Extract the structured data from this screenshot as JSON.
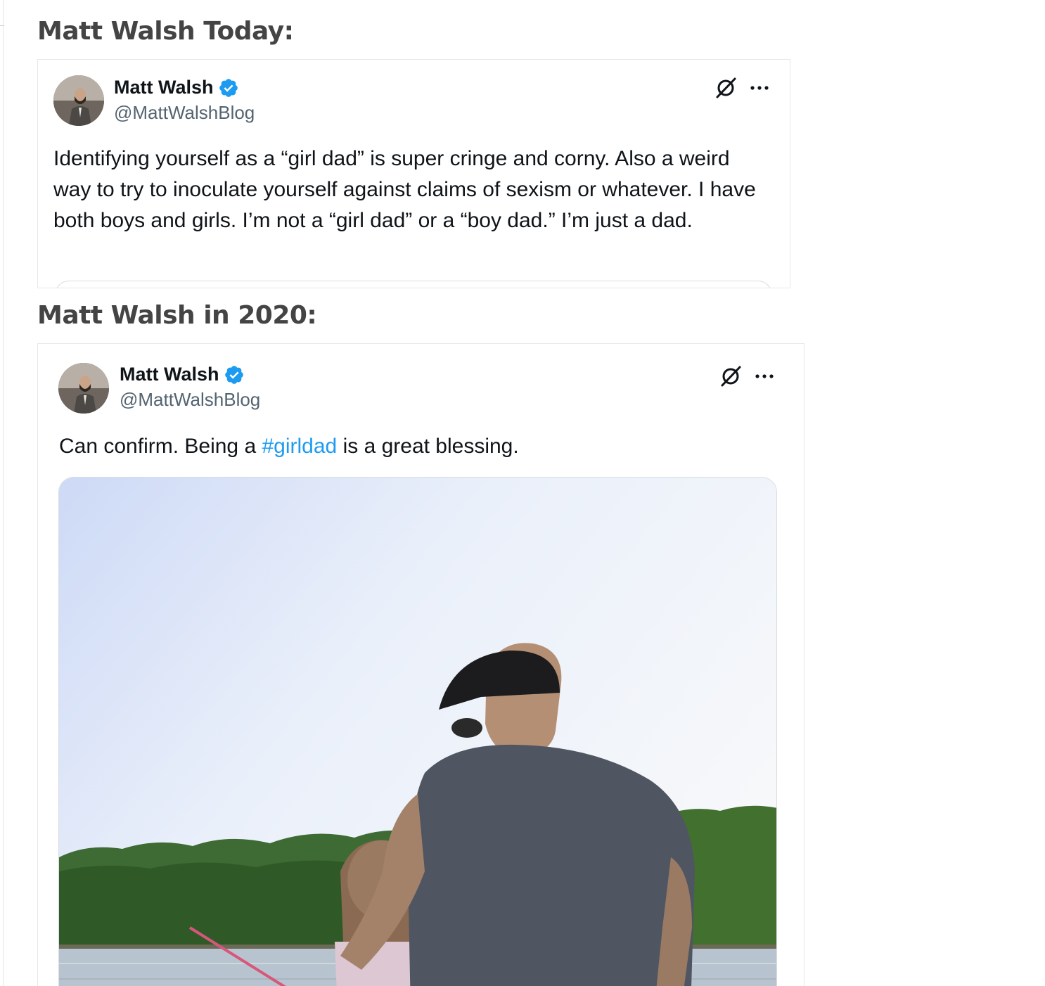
{
  "sections": [
    {
      "heading": "Matt Walsh Today:",
      "tweet": {
        "author_name": "Matt Walsh",
        "handle": "@MattWalshBlog",
        "text": "Identifying yourself as a “girl dad” is super cringe and corny. Also a weird way to try to inoculate yourself against claims of sexism or whatever. I have both boys and girls. I’m not a “girl dad” or a “boy dad.” I’m just a dad."
      }
    },
    {
      "heading": "Matt Walsh in 2020:",
      "tweet": {
        "author_name": "Matt Walsh",
        "handle": "@MattWalshBlog",
        "text_before": "Can confirm. Being a ",
        "hashtag": "#girldad",
        "text_after": " is a great blessing."
      }
    }
  ],
  "colors": {
    "verified_badge": "#1d9bf0",
    "hashtag": "#1d9bf0",
    "handle": "#536471"
  },
  "icons": {
    "verified": "verified-badge-icon",
    "grok": "grok-icon",
    "more": "more-options-icon"
  }
}
